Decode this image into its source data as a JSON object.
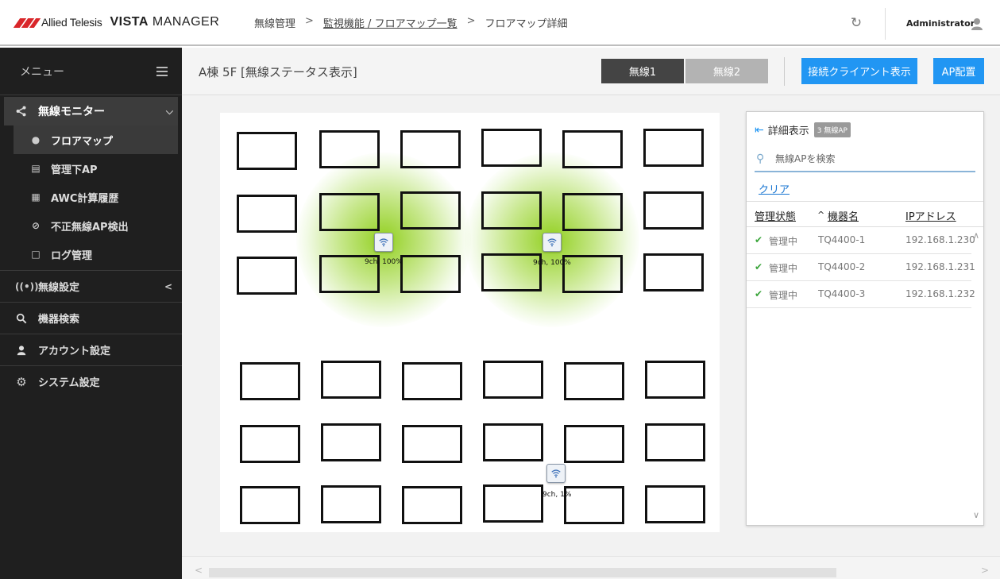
{
  "header": {
    "brand1": "Allied Telesis",
    "brand2_a": "VISTA",
    "brand2_b": "MANAGER",
    "breadcrumb": [
      "無線管理",
      "監視機能 / フロアマップ一覧",
      "フロアマップ詳細"
    ],
    "breadcrumb_sep": ">",
    "user": "Administrator",
    "icons": [
      "refresh-icon",
      "user-icon"
    ]
  },
  "sidebar": {
    "menu_label": "メニュー",
    "group": {
      "label": "無線モニター",
      "children": [
        {
          "label": "フロアマップ",
          "icon": "pin-icon",
          "active": true
        },
        {
          "label": "管理下AP",
          "icon": "device-icon"
        },
        {
          "label": "AWC計算履歴",
          "icon": "calculator-icon"
        },
        {
          "label": "不正無線AP検出",
          "icon": "ban-icon"
        },
        {
          "label": "ログ管理",
          "icon": "document-icon"
        }
      ]
    },
    "items": [
      {
        "label": "無線設定",
        "icon": "antenna-icon"
      },
      {
        "label": "機器検索",
        "icon": "search-icon"
      },
      {
        "label": "アカウント設定",
        "icon": "user-icon"
      },
      {
        "label": "システム設定",
        "icon": "gear-icon"
      }
    ]
  },
  "main": {
    "title": "A棟 5F [無線ステータス表示]",
    "tabs": [
      "無線1",
      "無線2"
    ],
    "buttons": {
      "client": "接続クライアント表示",
      "ap": "AP配置"
    }
  },
  "map": {
    "aps": [
      {
        "label": "9ch, 100%",
        "coverage": 1.0
      },
      {
        "label": "9ch, 100%",
        "coverage": 1.0
      },
      {
        "label": "9ch, 1%",
        "coverage": 0.01
      }
    ]
  },
  "panel": {
    "title": "詳細表示",
    "badge": "3 無線AP",
    "search_placeholder": "無線APを検索",
    "clear": "クリア",
    "columns": [
      "管理状態",
      "機器名",
      "IPアドレス"
    ],
    "sort_indicator": "^",
    "rows": [
      {
        "status": "管理中",
        "name": "TQ4400-1",
        "ip": "192.168.1.230"
      },
      {
        "status": "管理中",
        "name": "TQ4400-2",
        "ip": "192.168.1.231"
      },
      {
        "status": "管理中",
        "name": "TQ4400-3",
        "ip": "192.168.1.232"
      }
    ]
  },
  "colors": {
    "accent": "#2196f3",
    "sidebar_bg": "#1f1f1f",
    "status_ok": "#3aa53a",
    "coverage": "#8ccd14"
  }
}
